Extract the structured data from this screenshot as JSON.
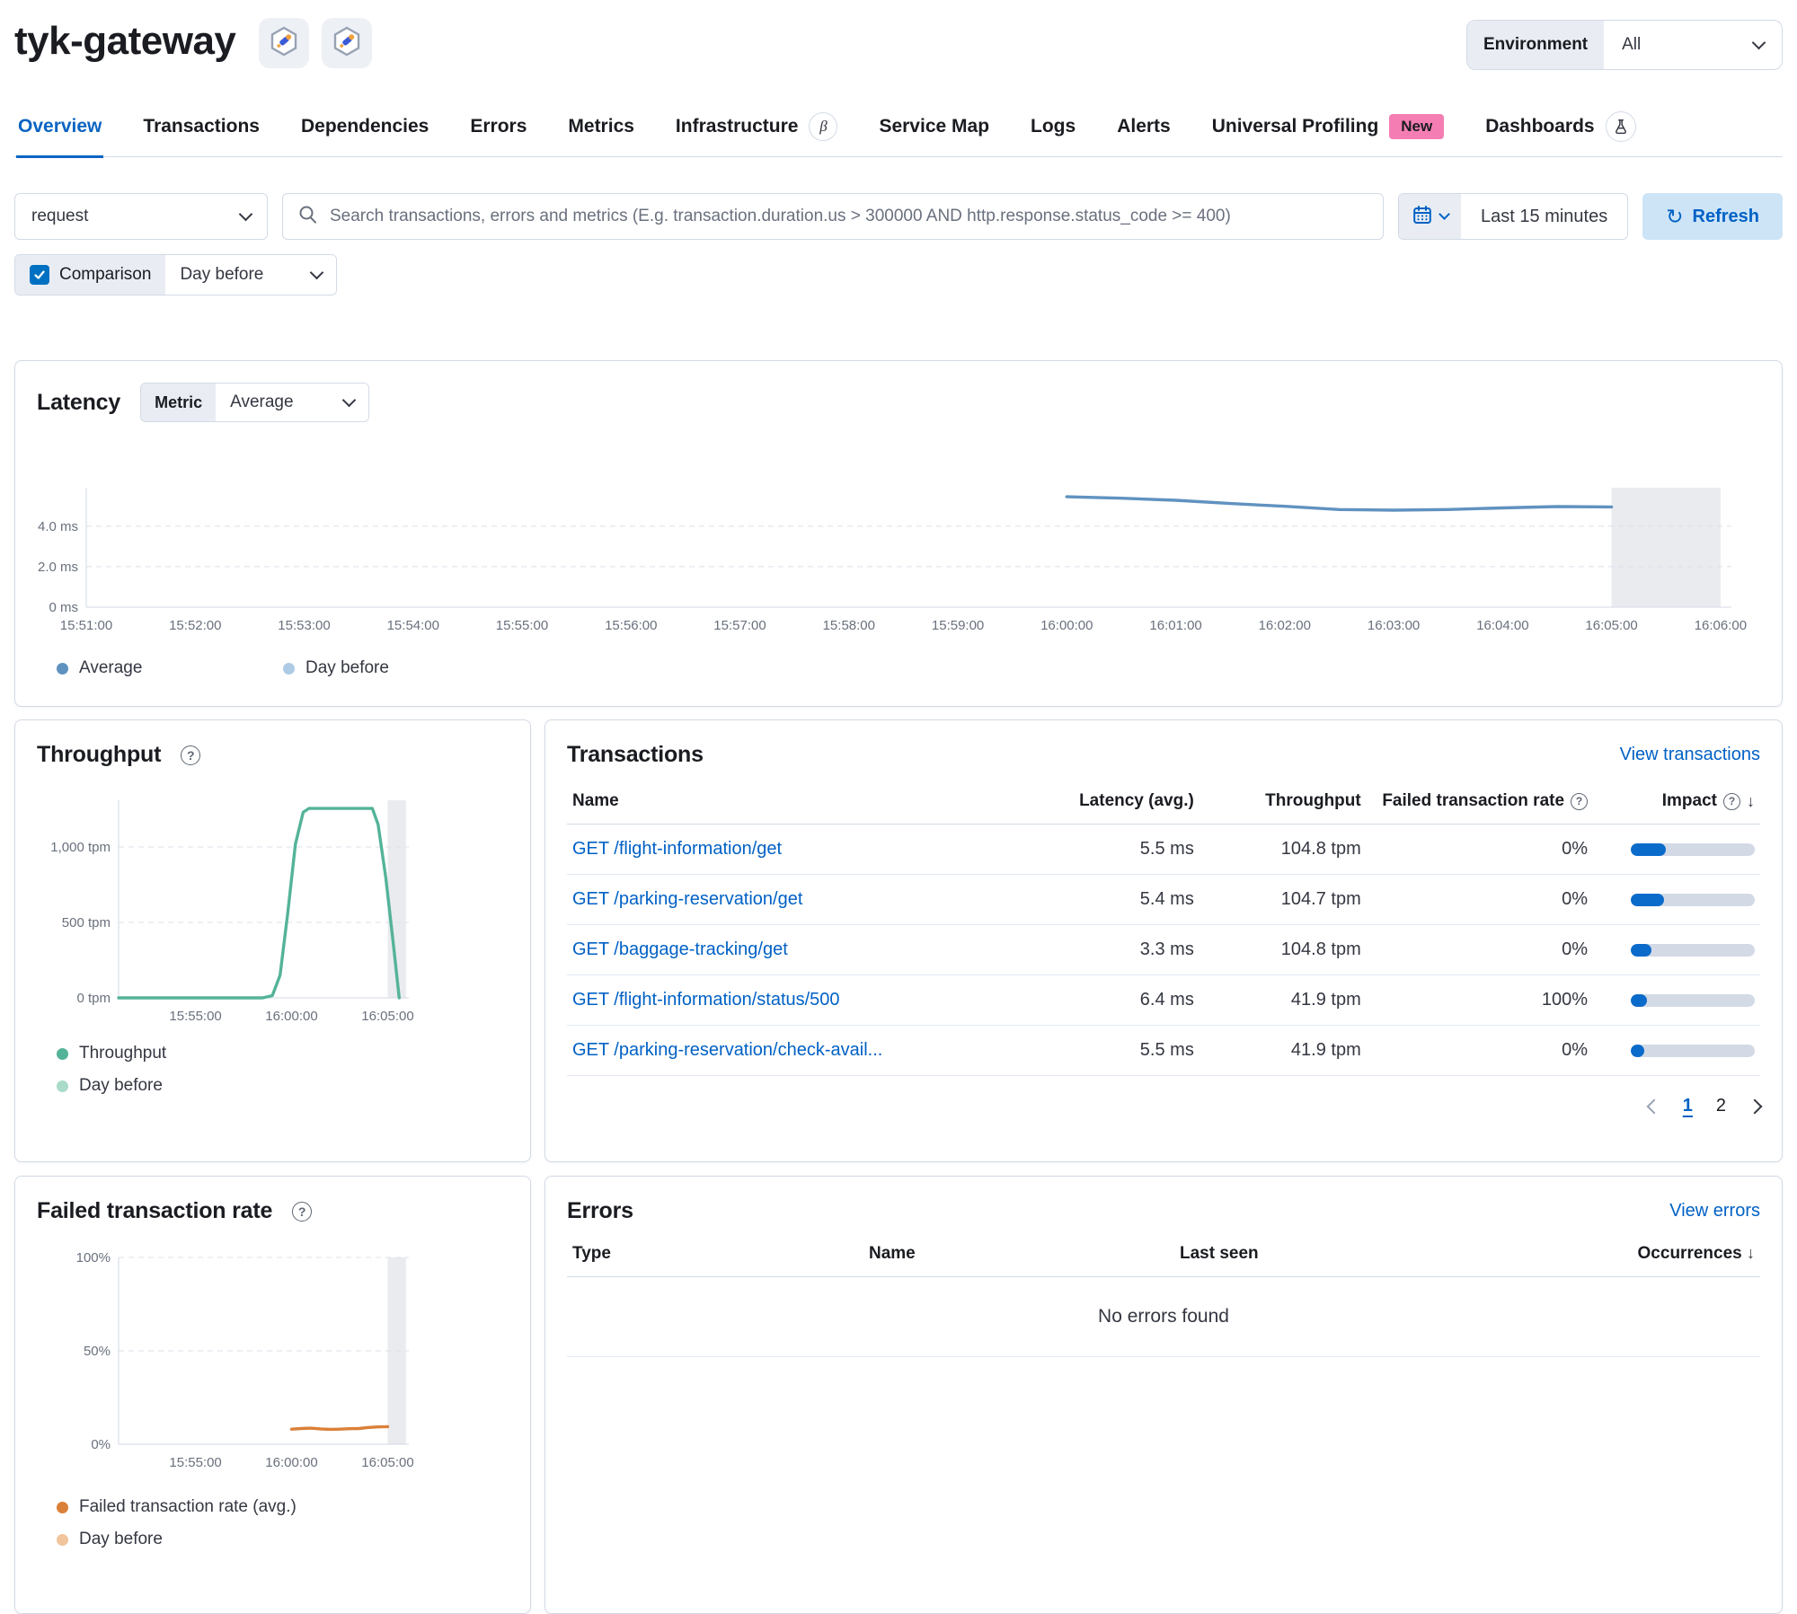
{
  "header": {
    "title": "tyk-gateway",
    "environment_label": "Environment",
    "environment_value": "All"
  },
  "tabs": [
    {
      "label": "Overview",
      "active": true
    },
    {
      "label": "Transactions"
    },
    {
      "label": "Dependencies"
    },
    {
      "label": "Errors"
    },
    {
      "label": "Metrics"
    },
    {
      "label": "Infrastructure",
      "beta": "β"
    },
    {
      "label": "Service Map"
    },
    {
      "label": "Logs"
    },
    {
      "label": "Alerts"
    },
    {
      "label": "Universal Profiling",
      "badge": "New"
    },
    {
      "label": "Dashboards"
    }
  ],
  "filter_bar": {
    "transaction_type": "request",
    "search_placeholder": "Search transactions, errors and metrics (E.g. transaction.duration.us > 300000 AND http.response.status_code >= 400)",
    "time_range": "Last 15 minutes",
    "refresh_label": "Refresh",
    "comparison_label": "Comparison",
    "comparison_checked": true,
    "comparison_value": "Day before"
  },
  "latency": {
    "title": "Latency",
    "metric_label": "Metric",
    "metric_value": "Average",
    "legend": [
      {
        "label": "Average",
        "color": "#6092C0"
      },
      {
        "label": "Day before",
        "color": "#AECBE5"
      }
    ]
  },
  "throughput": {
    "title": "Throughput",
    "legend": [
      {
        "label": "Throughput",
        "color": "#54B399"
      },
      {
        "label": "Day before",
        "color": "#A9DBC8"
      }
    ]
  },
  "transactions": {
    "title": "Transactions",
    "view_link": "View transactions",
    "columns": {
      "name": "Name",
      "latency": "Latency (avg.)",
      "throughput": "Throughput",
      "ftr": "Failed transaction rate",
      "impact": "Impact"
    },
    "rows": [
      {
        "name": "GET /flight-information/get",
        "latency": "5.5 ms",
        "throughput": "104.8 tpm",
        "ftr": "0%",
        "impact_pct": 28
      },
      {
        "name": "GET /parking-reservation/get",
        "latency": "5.4 ms",
        "throughput": "104.7 tpm",
        "ftr": "0%",
        "impact_pct": 27
      },
      {
        "name": "GET /baggage-tracking/get",
        "latency": "3.3 ms",
        "throughput": "104.8 tpm",
        "ftr": "0%",
        "impact_pct": 17
      },
      {
        "name": "GET /flight-information/status/500",
        "latency": "6.4 ms",
        "throughput": "41.9 tpm",
        "ftr": "100%",
        "impact_pct": 13
      },
      {
        "name": "GET /parking-reservation/check-avail...",
        "latency": "5.5 ms",
        "throughput": "41.9 tpm",
        "ftr": "0%",
        "impact_pct": 11
      }
    ],
    "pagination": {
      "page1": "1",
      "page2": "2",
      "active": "1"
    }
  },
  "ftr": {
    "title": "Failed transaction rate",
    "legend": [
      {
        "label": "Failed transaction rate (avg.)",
        "color": "#DB8038"
      },
      {
        "label": "Day before",
        "color": "#F1C49C"
      }
    ]
  },
  "errors": {
    "title": "Errors",
    "view_link": "View errors",
    "columns": {
      "type": "Type",
      "name": "Name",
      "last_seen": "Last seen",
      "occurrences": "Occurrences"
    },
    "empty_message": "No errors found"
  },
  "chart_data": [
    {
      "id": "latency",
      "type": "line",
      "title": "Latency",
      "ylabel": "ms",
      "xlim": [
        0,
        15.1
      ],
      "ylim": [
        0,
        5.9
      ],
      "x_ticks": [
        {
          "t": 0,
          "label": "15:51:00"
        },
        {
          "t": 1,
          "label": "15:52:00"
        },
        {
          "t": 2,
          "label": "15:53:00"
        },
        {
          "t": 3,
          "label": "15:54:00"
        },
        {
          "t": 4,
          "label": "15:55:00"
        },
        {
          "t": 5,
          "label": "15:56:00"
        },
        {
          "t": 6,
          "label": "15:57:00"
        },
        {
          "t": 7,
          "label": "15:58:00"
        },
        {
          "t": 8,
          "label": "15:59:00"
        },
        {
          "t": 9,
          "label": "16:00:00"
        },
        {
          "t": 10,
          "label": "16:01:00"
        },
        {
          "t": 11,
          "label": "16:02:00"
        },
        {
          "t": 12,
          "label": "16:03:00"
        },
        {
          "t": 13,
          "label": "16:04:00"
        },
        {
          "t": 14,
          "label": "16:05:00"
        },
        {
          "t": 15,
          "label": "16:06:00"
        }
      ],
      "y_ticks": [
        {
          "v": 0,
          "label": "0 ms"
        },
        {
          "v": 2,
          "label": "2.0 ms"
        },
        {
          "v": 4,
          "label": "4.0 ms"
        }
      ],
      "annotation": {
        "from": 14,
        "to": 15
      },
      "series": [
        {
          "name": "Average",
          "color": "#6092C0",
          "points": [
            [
              9,
              5.45
            ],
            [
              9.5,
              5.38
            ],
            [
              10,
              5.28
            ],
            [
              10.5,
              5.12
            ],
            [
              11,
              4.98
            ],
            [
              11.5,
              4.82
            ],
            [
              12,
              4.79
            ],
            [
              12.5,
              4.82
            ],
            [
              13,
              4.9
            ],
            [
              13.5,
              4.97
            ],
            [
              14,
              4.95
            ]
          ]
        }
      ]
    },
    {
      "id": "throughput",
      "type": "line",
      "title": "Throughput",
      "ylabel": "tpm",
      "xlim": [
        0,
        15.1
      ],
      "ylim": [
        0,
        1310
      ],
      "x_ticks": [
        {
          "t": 4,
          "label": "15:55:00"
        },
        {
          "t": 9,
          "label": "16:00:00"
        },
        {
          "t": 14,
          "label": "16:05:00"
        }
      ],
      "y_ticks": [
        {
          "v": 0,
          "label": "0 tpm"
        },
        {
          "v": 500,
          "label": "500 tpm"
        },
        {
          "v": 1000,
          "label": "1,000 tpm"
        }
      ],
      "annotation": {
        "from": 14,
        "to": 14.95
      },
      "series": [
        {
          "name": "Throughput",
          "color": "#54B399",
          "points": [
            [
              0,
              0
            ],
            [
              7.5,
              0
            ],
            [
              8,
              15
            ],
            [
              8.4,
              150
            ],
            [
              8.8,
              560
            ],
            [
              9.2,
              1020
            ],
            [
              9.6,
              1230
            ],
            [
              9.9,
              1256
            ],
            [
              13.2,
              1256
            ],
            [
              13.5,
              1150
            ],
            [
              13.9,
              800
            ],
            [
              14.3,
              350
            ],
            [
              14.6,
              0
            ]
          ]
        }
      ]
    },
    {
      "id": "ftr",
      "type": "line",
      "title": "Failed transaction rate",
      "ylabel": "%",
      "xlim": [
        0,
        15.1
      ],
      "ylim": [
        0,
        100
      ],
      "x_ticks": [
        {
          "t": 4,
          "label": "15:55:00"
        },
        {
          "t": 9,
          "label": "16:00:00"
        },
        {
          "t": 14,
          "label": "16:05:00"
        }
      ],
      "y_ticks": [
        {
          "v": 0,
          "label": "0%"
        },
        {
          "v": 50,
          "label": "50%"
        },
        {
          "v": 100,
          "label": "100%"
        }
      ],
      "annotation": {
        "from": 14,
        "to": 14.95
      },
      "series": [
        {
          "name": "Failed transaction rate (avg.)",
          "color": "#DB8038",
          "points": [
            [
              9,
              8.1
            ],
            [
              9.5,
              8.4
            ],
            [
              10,
              8.6
            ],
            [
              10.5,
              8.2
            ],
            [
              11,
              8.0
            ],
            [
              11.5,
              8.1
            ],
            [
              12,
              8.3
            ],
            [
              12.5,
              8.4
            ],
            [
              13,
              9.0
            ],
            [
              13.5,
              9.3
            ],
            [
              14,
              9.4
            ]
          ]
        }
      ]
    }
  ]
}
